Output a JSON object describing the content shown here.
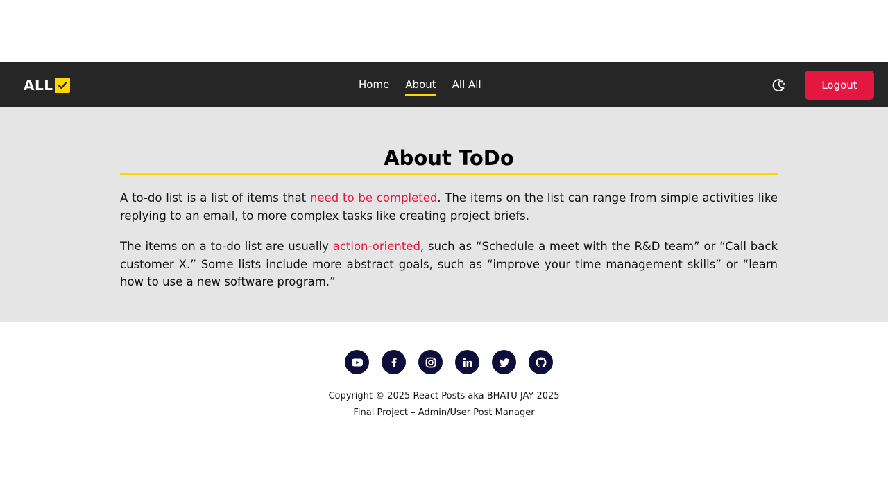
{
  "brand": {
    "text": "ALL"
  },
  "nav": {
    "links": [
      "Home",
      "About",
      "All All"
    ],
    "active": "About"
  },
  "actions": {
    "logout_label": "Logout"
  },
  "about": {
    "title": "About ToDo",
    "p1_before": "A to-do list is a list of items that ",
    "p1_highlight": "need to be completed",
    "p1_after": ". The items on the list can range from simple activities like replying to an email, to more complex tasks like creating project briefs.",
    "p2_before": "The items on a to-do list are usually ",
    "p2_highlight": "action-oriented",
    "p2_after": ", such as “Schedule a meet with the R&D team” or “Call back customer X.” Some lists include more abstract goals, such as “improve your time management skills” or “learn how to use a new software program.”"
  },
  "footer": {
    "socials": [
      "youtube-icon",
      "facebook-icon",
      "instagram-icon",
      "linkedin-icon",
      "twitter-icon",
      "github-icon"
    ],
    "copyright": "Copyright © 2025 React Posts aka BHATU JAY 2025",
    "subline": "Final Project – Admin/User Post Manager"
  },
  "colors": {
    "navbar": "#262626",
    "accent": "#ffd600",
    "danger": "#e3173f",
    "content_bg": "#e5e5e5",
    "social_bg": "#0e0e3a"
  }
}
